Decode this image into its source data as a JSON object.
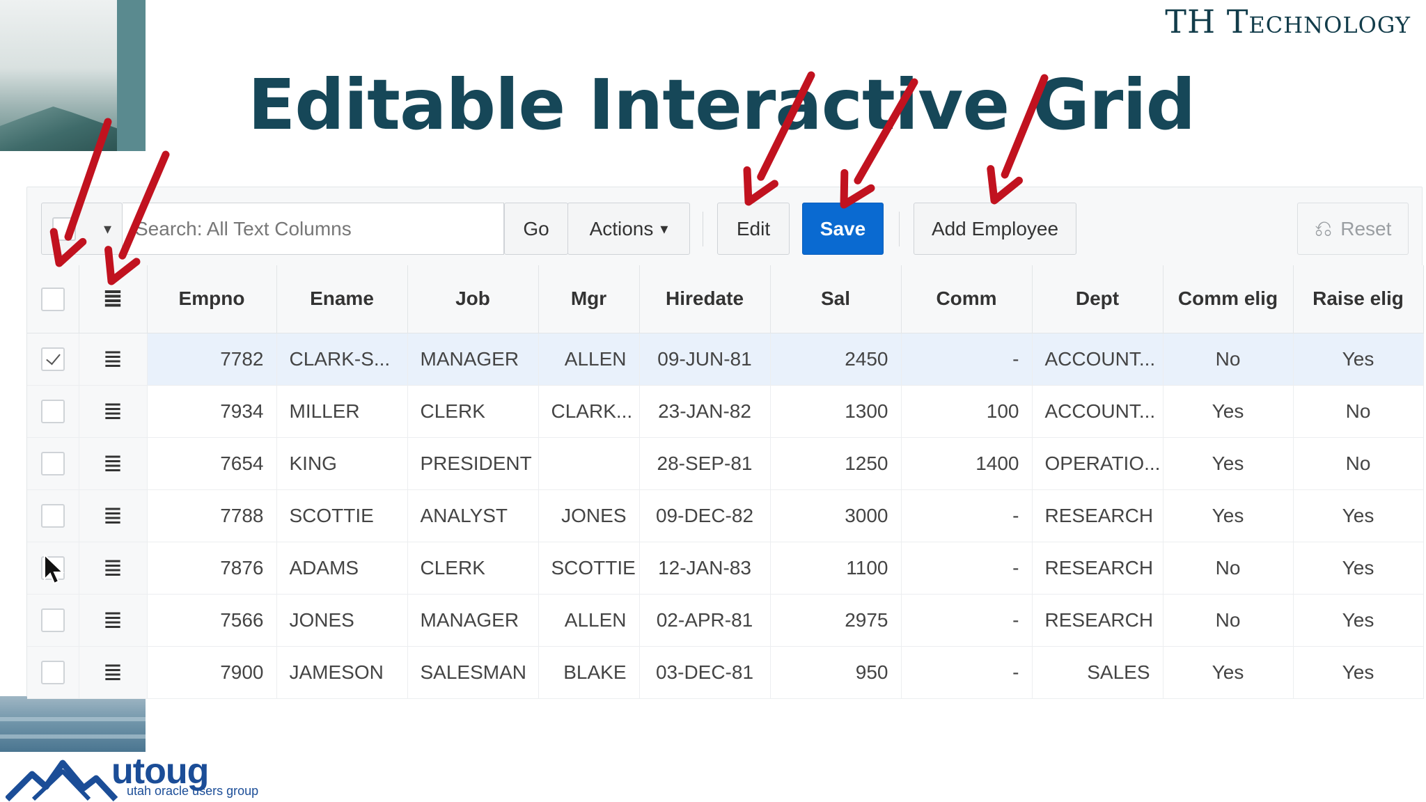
{
  "brand": "TH Technology",
  "slide_title": "Editable Interactive Grid",
  "toolbar": {
    "search_placeholder": "Search: All Text Columns",
    "go_label": "Go",
    "actions_label": "Actions",
    "edit_label": "Edit",
    "save_label": "Save",
    "add_employee_label": "Add Employee",
    "reset_label": "Reset"
  },
  "columns": [
    "Empno",
    "Ename",
    "Job",
    "Mgr",
    "Hiredate",
    "Sal",
    "Comm",
    "Dept",
    "Comm elig",
    "Raise elig"
  ],
  "rows": [
    {
      "checked": true,
      "empno": "7782",
      "ename": "CLARK-S...",
      "job": "MANAGER",
      "mgr": "ALLEN",
      "hiredate": "09-JUN-81",
      "sal": "2450",
      "comm": "-",
      "dept": "ACCOUNT...",
      "comm_elig": "No",
      "raise_elig": "Yes"
    },
    {
      "checked": false,
      "empno": "7934",
      "ename": "MILLER",
      "job": "CLERK",
      "mgr": "CLARK...",
      "hiredate": "23-JAN-82",
      "sal": "1300",
      "comm": "100",
      "dept": "ACCOUNT...",
      "comm_elig": "Yes",
      "raise_elig": "No"
    },
    {
      "checked": false,
      "empno": "7654",
      "ename": "KING",
      "job": "PRESIDENT",
      "mgr": "",
      "hiredate": "28-SEP-81",
      "sal": "1250",
      "comm": "1400",
      "dept": "OPERATIO...",
      "comm_elig": "Yes",
      "raise_elig": "No"
    },
    {
      "checked": false,
      "empno": "7788",
      "ename": "SCOTTIE",
      "job": "ANALYST",
      "mgr": "JONES",
      "hiredate": "09-DEC-82",
      "sal": "3000",
      "comm": "-",
      "dept": "RESEARCH",
      "comm_elig": "Yes",
      "raise_elig": "Yes"
    },
    {
      "checked": false,
      "empno": "7876",
      "ename": "ADAMS",
      "job": "CLERK",
      "mgr": "SCOTTIE",
      "hiredate": "12-JAN-83",
      "sal": "1100",
      "comm": "-",
      "dept": "RESEARCH",
      "comm_elig": "No",
      "raise_elig": "Yes"
    },
    {
      "checked": false,
      "empno": "7566",
      "ename": "JONES",
      "job": "MANAGER",
      "mgr": "ALLEN",
      "hiredate": "02-APR-81",
      "sal": "2975",
      "comm": "-",
      "dept": "RESEARCH",
      "comm_elig": "No",
      "raise_elig": "Yes"
    },
    {
      "checked": false,
      "empno": "7900",
      "ename": "JAMESON",
      "job": "SALESMAN",
      "mgr": "BLAKE",
      "hiredate": "03-DEC-81",
      "sal": "950",
      "comm": "-",
      "dept": "SALES",
      "comm_elig": "Yes",
      "raise_elig": "Yes"
    }
  ],
  "footer": {
    "logo_name": "utoug",
    "logo_subtitle": "utah oracle users group"
  },
  "colors": {
    "title": "#164758",
    "save_button": "#0a6ad1",
    "arrows": "#c1121f",
    "selected_row": "#e9f1fb"
  },
  "icons": {
    "column_selector": "checkbox-icon",
    "row_actions": "hamburger-menu-icon",
    "reset": "undo-icon"
  }
}
